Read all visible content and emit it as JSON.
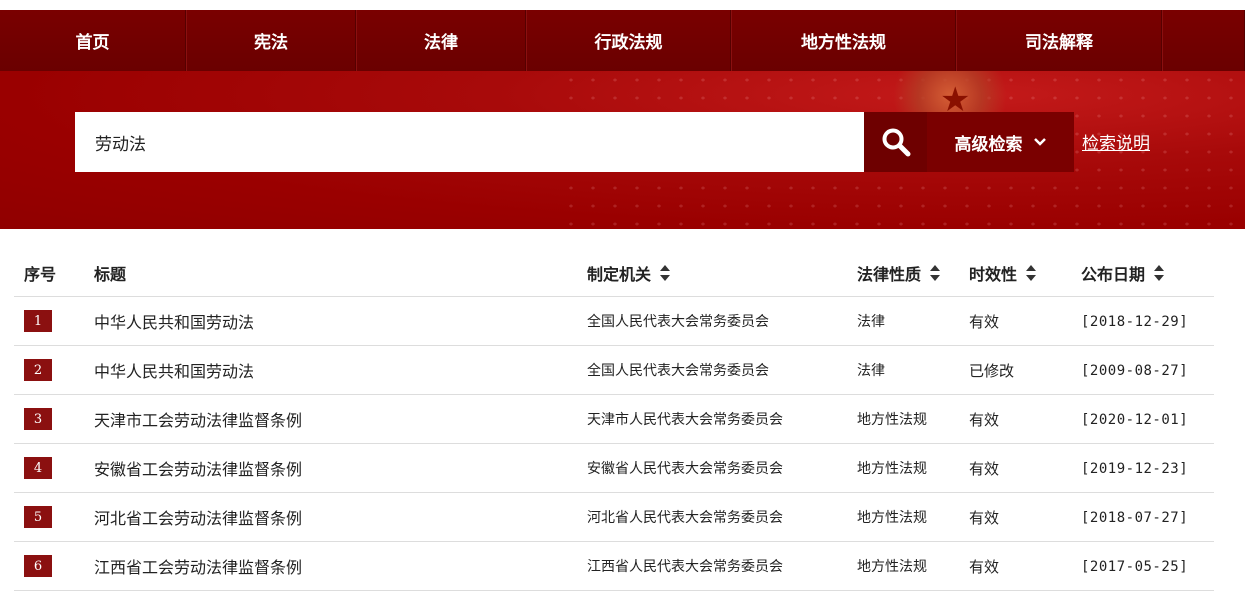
{
  "nav": {
    "items": [
      {
        "label": "首页",
        "width": 186
      },
      {
        "label": "宪法",
        "width": 170
      },
      {
        "label": "法律",
        "width": 170
      },
      {
        "label": "行政法规",
        "width": 205
      },
      {
        "label": "地方性法规",
        "width": 225
      },
      {
        "label": "司法解释",
        "width": 206
      }
    ]
  },
  "search": {
    "value": "劳动法",
    "advanced_label": "高级检索",
    "help_label": "检索说明"
  },
  "table": {
    "headers": {
      "index": "序号",
      "title": "标题",
      "organ": "制定机关",
      "nature": "法律性质",
      "status": "时效性",
      "date": "公布日期"
    },
    "rows": [
      {
        "index": "1",
        "title": "中华人民共和国劳动法",
        "organ": "全国人民代表大会常务委员会",
        "nature": "法律",
        "status": "有效",
        "date": "[2018-12-29]"
      },
      {
        "index": "2",
        "title": "中华人民共和国劳动法",
        "organ": "全国人民代表大会常务委员会",
        "nature": "法律",
        "status": "已修改",
        "date": "[2009-08-27]"
      },
      {
        "index": "3",
        "title": "天津市工会劳动法律监督条例",
        "organ": "天津市人民代表大会常务委员会",
        "nature": "地方性法规",
        "status": "有效",
        "date": "[2020-12-01]"
      },
      {
        "index": "4",
        "title": "安徽省工会劳动法律监督条例",
        "organ": "安徽省人民代表大会常务委员会",
        "nature": "地方性法规",
        "status": "有效",
        "date": "[2019-12-23]"
      },
      {
        "index": "5",
        "title": "河北省工会劳动法律监督条例",
        "organ": "河北省人民代表大会常务委员会",
        "nature": "地方性法规",
        "status": "有效",
        "date": "[2018-07-27]"
      },
      {
        "index": "6",
        "title": "江西省工会劳动法律监督条例",
        "organ": "江西省人民代表大会常务委员会",
        "nature": "地方性法规",
        "status": "有效",
        "date": "[2017-05-25]"
      }
    ]
  },
  "colors": {
    "nav_bg": "#6e0000",
    "banner_bg": "#a00000",
    "index_badge": "#8b1010"
  }
}
